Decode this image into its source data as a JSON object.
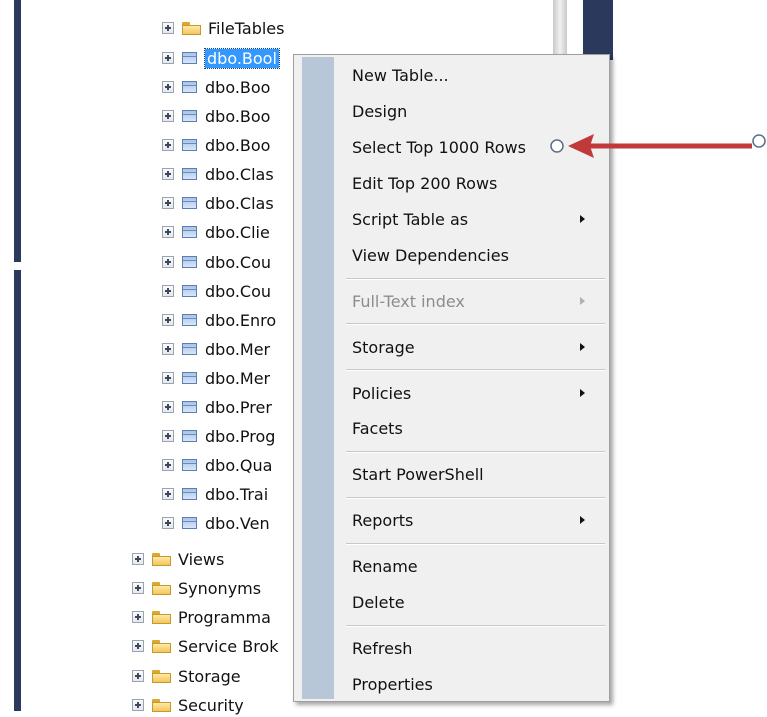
{
  "tree": {
    "items": [
      {
        "label": "FileTables",
        "icon": "folder-icon",
        "selected": false
      },
      {
        "label": "dbo.Bool",
        "icon": "table-icon",
        "selected": true
      },
      {
        "label": "dbo.Boo",
        "icon": "table-icon",
        "selected": false
      },
      {
        "label": "dbo.Boo",
        "icon": "table-icon",
        "selected": false
      },
      {
        "label": "dbo.Boo",
        "icon": "table-icon",
        "selected": false
      },
      {
        "label": "dbo.Clas",
        "icon": "table-icon",
        "selected": false
      },
      {
        "label": "dbo.Clas",
        "icon": "table-icon",
        "selected": false
      },
      {
        "label": "dbo.Clie",
        "icon": "table-icon",
        "selected": false
      },
      {
        "label": "dbo.Cou",
        "icon": "table-icon",
        "selected": false
      },
      {
        "label": "dbo.Cou",
        "icon": "table-icon",
        "selected": false
      },
      {
        "label": "dbo.Enro",
        "icon": "table-icon",
        "selected": false
      },
      {
        "label": "dbo.Mer",
        "icon": "table-icon",
        "selected": false
      },
      {
        "label": "dbo.Mer",
        "icon": "table-icon",
        "selected": false
      },
      {
        "label": "dbo.Prer",
        "icon": "table-icon",
        "selected": false
      },
      {
        "label": "dbo.Prog",
        "icon": "table-icon",
        "selected": false
      },
      {
        "label": "dbo.Qua",
        "icon": "table-icon",
        "selected": false
      },
      {
        "label": "dbo.Trai",
        "icon": "table-icon",
        "selected": false
      },
      {
        "label": "dbo.Ven",
        "icon": "table-icon",
        "selected": false
      },
      {
        "label": "Views",
        "icon": "folder-icon",
        "selected": false
      },
      {
        "label": "Synonyms",
        "icon": "folder-icon",
        "selected": false
      },
      {
        "label": "Programma",
        "icon": "folder-icon",
        "selected": false
      },
      {
        "label": "Service Brok",
        "icon": "folder-icon",
        "selected": false
      },
      {
        "label": "Storage",
        "icon": "folder-icon",
        "selected": false
      },
      {
        "label": "Security",
        "icon": "folder-icon",
        "selected": false
      }
    ]
  },
  "context_menu": {
    "items": [
      {
        "label": "New Table...",
        "submenu": false,
        "disabled": false
      },
      {
        "label": "Design",
        "submenu": false,
        "disabled": false
      },
      {
        "label": "Select Top 1000 Rows",
        "submenu": false,
        "disabled": false
      },
      {
        "label": "Edit Top 200 Rows",
        "submenu": false,
        "disabled": false
      },
      {
        "label": "Script Table as",
        "submenu": true,
        "disabled": false
      },
      {
        "label": "View Dependencies",
        "submenu": false,
        "disabled": false
      },
      {
        "label": "Full-Text index",
        "submenu": true,
        "disabled": true
      },
      {
        "label": "Storage",
        "submenu": true,
        "disabled": false
      },
      {
        "label": "Policies",
        "submenu": true,
        "disabled": false
      },
      {
        "label": "Facets",
        "submenu": false,
        "disabled": false
      },
      {
        "label": "Start PowerShell",
        "submenu": false,
        "disabled": false
      },
      {
        "label": "Reports",
        "submenu": true,
        "disabled": false
      },
      {
        "label": "Rename",
        "submenu": false,
        "disabled": false
      },
      {
        "label": "Delete",
        "submenu": false,
        "disabled": false
      },
      {
        "label": "Refresh",
        "submenu": false,
        "disabled": false
      },
      {
        "label": "Properties",
        "submenu": false,
        "disabled": false
      }
    ]
  },
  "annotation": {
    "icon": "red-arrow-icon",
    "color": "#c0393b",
    "marker_color": "#5a6e86"
  },
  "colors": {
    "selection": "#3399ff",
    "menu_background": "#f0f0f0",
    "menu_gutter": "#b7c7d8",
    "sidebar_bar": "#2b3a5c"
  }
}
